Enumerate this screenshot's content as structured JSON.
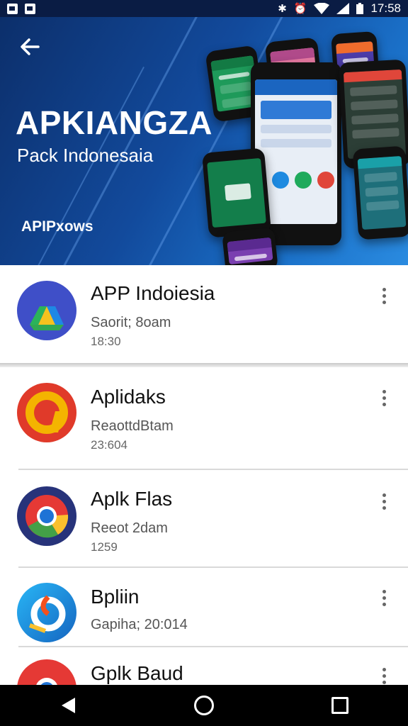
{
  "status_bar": {
    "time": "17:58"
  },
  "header": {
    "title": "APKIANGZA",
    "subtitle": "Pack Indonesaia",
    "brand": "APIPxows",
    "colors": {
      "background_start": "#0c2f6b",
      "background_end": "#2a8be0"
    }
  },
  "apps": [
    {
      "title": "APP Indoiesia",
      "subtitle": "Saorit; 8oam",
      "time": "18:30",
      "icon": "drive-style-icon"
    },
    {
      "title": "Aplidaks",
      "subtitle": "ReaottdBtam",
      "time": "23:604",
      "icon": "red-yellow-circle-icon"
    },
    {
      "title": "Aplk Flas",
      "subtitle": "Reeot 2dam",
      "time": "1259",
      "icon": "chrome-style-icon"
    },
    {
      "title": "Bpliin",
      "subtitle": "Gapiha; 20:014",
      "time": "",
      "icon": "blue-swirl-icon"
    },
    {
      "title": "Gplk Baud",
      "subtitle": "",
      "time": "",
      "icon": "chrome-red-icon"
    }
  ],
  "nav": {
    "back": "back-icon",
    "home": "home-icon",
    "recents": "recents-icon"
  }
}
